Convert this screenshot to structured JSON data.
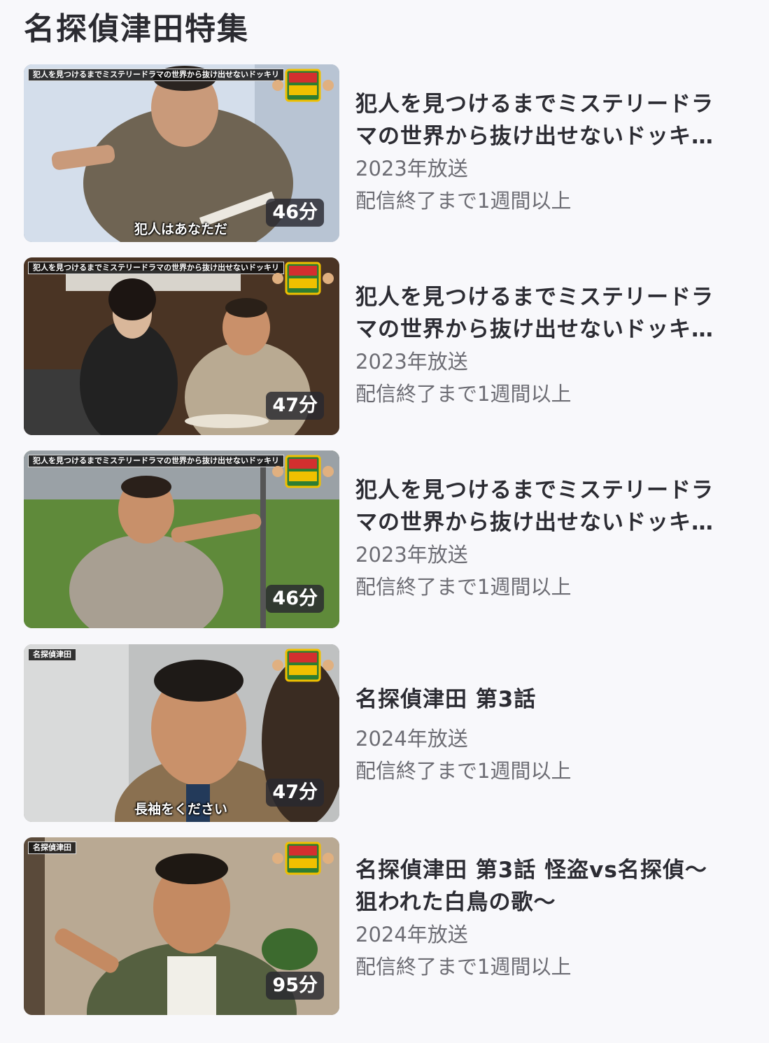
{
  "page": {
    "title": "名探偵津田特集"
  },
  "episodes": [
    {
      "title_line1": "犯人を見つけるまでミステリードラ",
      "title_line2": "マの世界から抜け出せないドッキ…",
      "year": "2023年放送",
      "availability": "配信終了まで1週間以上",
      "duration": "46分",
      "banner": "犯人を見つけるまでミステリードラマの世界から抜け出せないドッキリ",
      "subtitle": "犯人はあなただ"
    },
    {
      "title_line1": "犯人を見つけるまでミステリードラ",
      "title_line2": "マの世界から抜け出せないドッキ…",
      "year": "2023年放送",
      "availability": "配信終了まで1週間以上",
      "duration": "47分",
      "banner": "犯人を見つけるまでミステリードラマの世界から抜け出せないドッキリ",
      "subtitle": ""
    },
    {
      "title_line1": "犯人を見つけるまでミステリードラ",
      "title_line2": "マの世界から抜け出せないドッキ…",
      "year": "2023年放送",
      "availability": "配信終了まで1週間以上",
      "duration": "46分",
      "banner": "犯人を見つけるまでミステリードラマの世界から抜け出せないドッキリ",
      "subtitle": ""
    },
    {
      "title_line1": "名探偵津田 第3話",
      "title_line2": "",
      "year": "2024年放送",
      "availability": "配信終了まで1週間以上",
      "duration": "47分",
      "banner": "名探偵津田",
      "subtitle": "長袖をください"
    },
    {
      "title_line1": "名探偵津田 第3話 怪盗vs名探偵〜",
      "title_line2": "狙われた白鳥の歌〜",
      "year": "2024年放送",
      "availability": "配信終了まで1週間以上",
      "duration": "95分",
      "banner": "名探偵津田",
      "subtitle": ""
    }
  ]
}
